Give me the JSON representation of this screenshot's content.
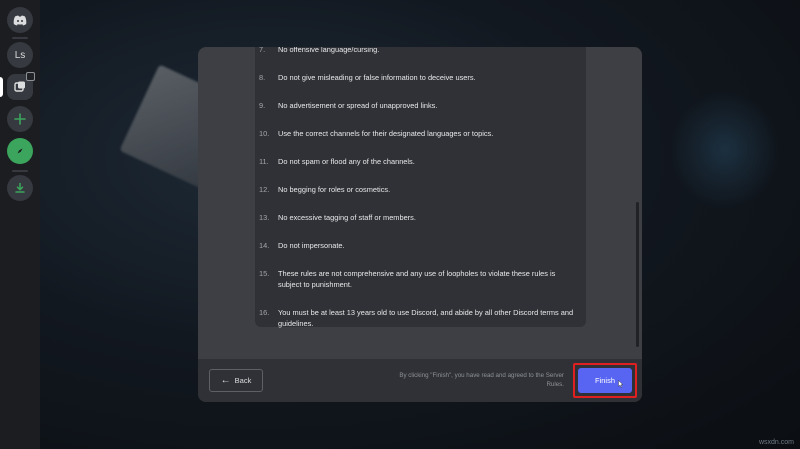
{
  "server_rail": {
    "user_initials": "Ls"
  },
  "rules": [
    {
      "num": "7.",
      "text": "No offensive language/cursing."
    },
    {
      "num": "8.",
      "text": "Do not give misleading or false information to deceive users."
    },
    {
      "num": "9.",
      "text": "No advertisement or spread of unapproved links."
    },
    {
      "num": "10.",
      "text": "Use the correct channels for their designated languages or topics."
    },
    {
      "num": "11.",
      "text": "Do not spam or flood any of the channels."
    },
    {
      "num": "12.",
      "text": "No begging for roles or cosmetics."
    },
    {
      "num": "13.",
      "text": "No excessive tagging of staff or members."
    },
    {
      "num": "14.",
      "text": "Do not impersonate."
    },
    {
      "num": "15.",
      "text": "These rules are not comprehensive and any use of loopholes to violate these rules is subject to punishment."
    },
    {
      "num": "16.",
      "text": "You must be at least 13 years old to use Discord, and abide by all other Discord terms and guidelines."
    }
  ],
  "footer": {
    "back_label": "Back",
    "agree_text": "By clicking \"Finish\", you have read and agreed to the Server Rules.",
    "finish_label": "Finish"
  },
  "watermark": "wsxdn.com",
  "colors": {
    "accent": "#5865f2",
    "highlight": "#e02020"
  }
}
